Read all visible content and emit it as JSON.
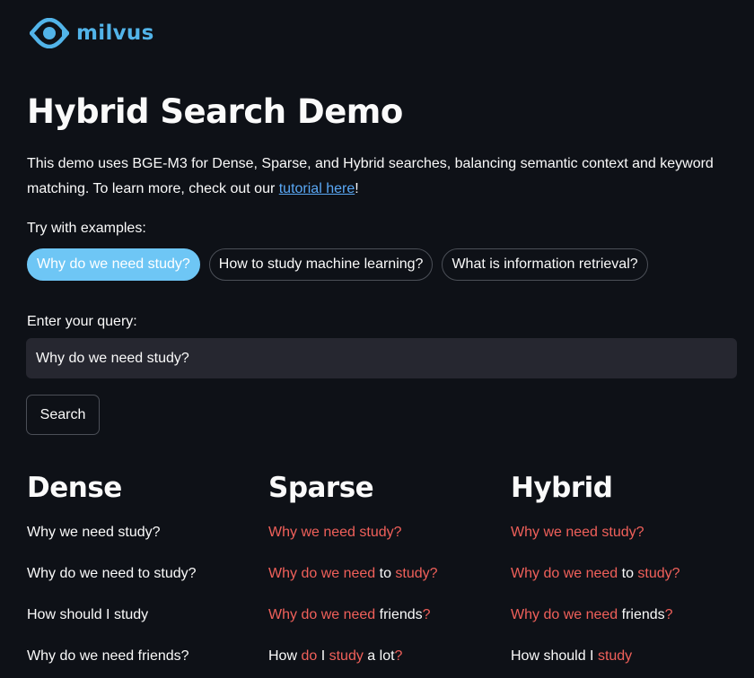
{
  "logo": {
    "text": "milvus"
  },
  "title": "Hybrid Search Demo",
  "description": {
    "text": "This demo uses BGE-M3 for Dense, Sparse, and Hybrid searches, balancing semantic context and keyword matching. To learn more, check out our ",
    "link_text": "tutorial here",
    "suffix": "!"
  },
  "examples": {
    "label": "Try with examples:",
    "items": [
      "Why do we need study?",
      "How to study machine learning?",
      "What is information retrieval?"
    ],
    "active_index": 0
  },
  "query": {
    "label": "Enter your query:",
    "value": "Why do we need study?"
  },
  "search_button": "Search",
  "colors": {
    "accent": "#6ec6f5",
    "highlight": "#f0605a",
    "link": "#5aa8f5",
    "brand": "#52b4e9"
  },
  "columns": [
    {
      "title": "Dense",
      "results": [
        [
          {
            "t": "Why we need study?",
            "h": false
          }
        ],
        [
          {
            "t": "Why do we need to study?",
            "h": false
          }
        ],
        [
          {
            "t": "How should I study",
            "h": false
          }
        ],
        [
          {
            "t": "Why do we need friends?",
            "h": false
          }
        ]
      ]
    },
    {
      "title": "Sparse",
      "results": [
        [
          {
            "t": "Why we need study?",
            "h": true
          }
        ],
        [
          {
            "t": "Why do we need",
            "h": true
          },
          {
            "t": " to ",
            "h": false
          },
          {
            "t": "study?",
            "h": true
          }
        ],
        [
          {
            "t": "Why do we need",
            "h": true
          },
          {
            "t": " friends",
            "h": false
          },
          {
            "t": "?",
            "h": true
          }
        ],
        [
          {
            "t": "How ",
            "h": false
          },
          {
            "t": "do",
            "h": true
          },
          {
            "t": " I ",
            "h": false
          },
          {
            "t": "study",
            "h": true
          },
          {
            "t": " a lot",
            "h": false
          },
          {
            "t": "?",
            "h": true
          }
        ]
      ]
    },
    {
      "title": "Hybrid",
      "results": [
        [
          {
            "t": "Why we need study?",
            "h": true
          }
        ],
        [
          {
            "t": "Why do we need",
            "h": true
          },
          {
            "t": " to ",
            "h": false
          },
          {
            "t": "study?",
            "h": true
          }
        ],
        [
          {
            "t": "Why do we need",
            "h": true
          },
          {
            "t": " friends",
            "h": false
          },
          {
            "t": "?",
            "h": true
          }
        ],
        [
          {
            "t": "How should I ",
            "h": false
          },
          {
            "t": "study",
            "h": true
          }
        ]
      ]
    }
  ]
}
